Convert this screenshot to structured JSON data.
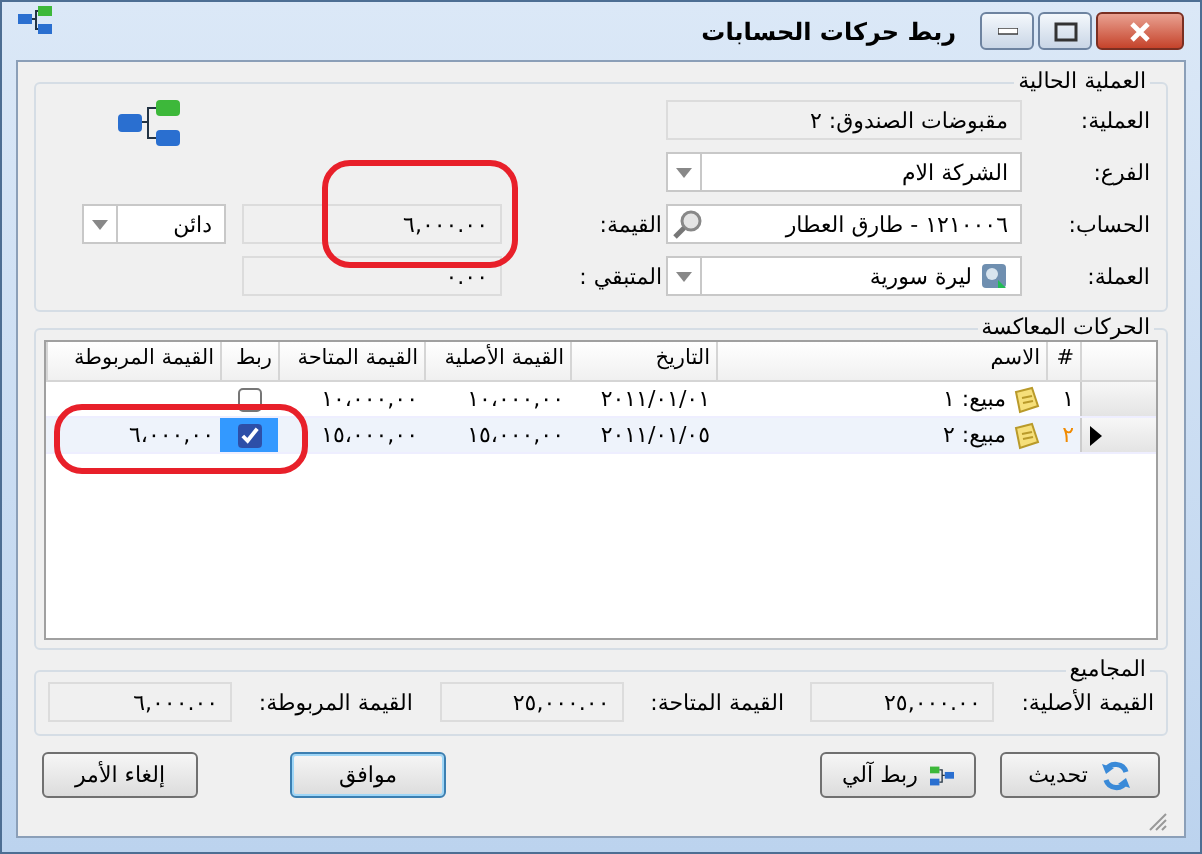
{
  "window": {
    "title": "ربط حركات الحسابات"
  },
  "current_operation": {
    "title": "العملية الحالية",
    "fields": [
      {
        "label": "العملية:",
        "value": "مقبوضات الصندوق: ٢",
        "kind": "text"
      },
      {
        "label": "الفرع:",
        "value": "الشركة الام",
        "kind": "dropdown"
      },
      {
        "label": "الحساب:",
        "value": "١٢١٠٠٠٦ - طارق العطار",
        "kind": "search"
      },
      {
        "label": "العملة:",
        "value": "ليرة سورية",
        "kind": "currency"
      }
    ],
    "amount": {
      "label": "القيمة:",
      "value": "٦,٠٠٠.٠٠",
      "circled": true
    },
    "side": {
      "value": "دائن"
    },
    "remaining": {
      "label": "المتبقي :",
      "value": "٠.٠٠"
    }
  },
  "reverse_movements": {
    "title": "الحركات المعاكسة",
    "columns": [
      "#",
      "الاسم",
      "التاريخ",
      "القيمة الأصلية",
      "القيمة المتاحة",
      "ربط",
      "القيمة المربوطة"
    ],
    "rows": [
      {
        "number": "١",
        "name": "مبيع: ١",
        "date": "٢٠١١/٠١/٠١",
        "original": "١٠،٠٠٠,٠٠",
        "available": "١٠،٠٠٠,٠٠",
        "linked": false,
        "selected": false,
        "circled": false
      },
      {
        "number": "٢",
        "name": "مبيع: ٢",
        "date": "٢٠١١/٠١/٠٥",
        "original": "١٥،٠٠٠,٠٠",
        "available": "١٥،٠٠٠,٠٠",
        "linked": true,
        "linked_value": "٦،٠٠٠,٠٠",
        "selected": true,
        "circled": true
      }
    ]
  },
  "totals": {
    "title": "المجاميع",
    "items": [
      {
        "label": "القيمة الأصلية:",
        "value": "٢٥,٠٠٠.٠٠"
      },
      {
        "label": "القيمة المتاحة:",
        "value": "٢٥,٠٠٠.٠٠"
      },
      {
        "label": "القيمة المربوطة:",
        "value": "٦,٠٠٠.٠٠"
      }
    ]
  },
  "buttons": [
    {
      "label": "تحديث",
      "kind": "refresh"
    },
    {
      "label": "ربط آلي",
      "kind": "link"
    },
    {
      "label": "موافق",
      "kind": "primary"
    },
    {
      "label": "إلغاء الأمر",
      "kind": "plain"
    }
  ]
}
